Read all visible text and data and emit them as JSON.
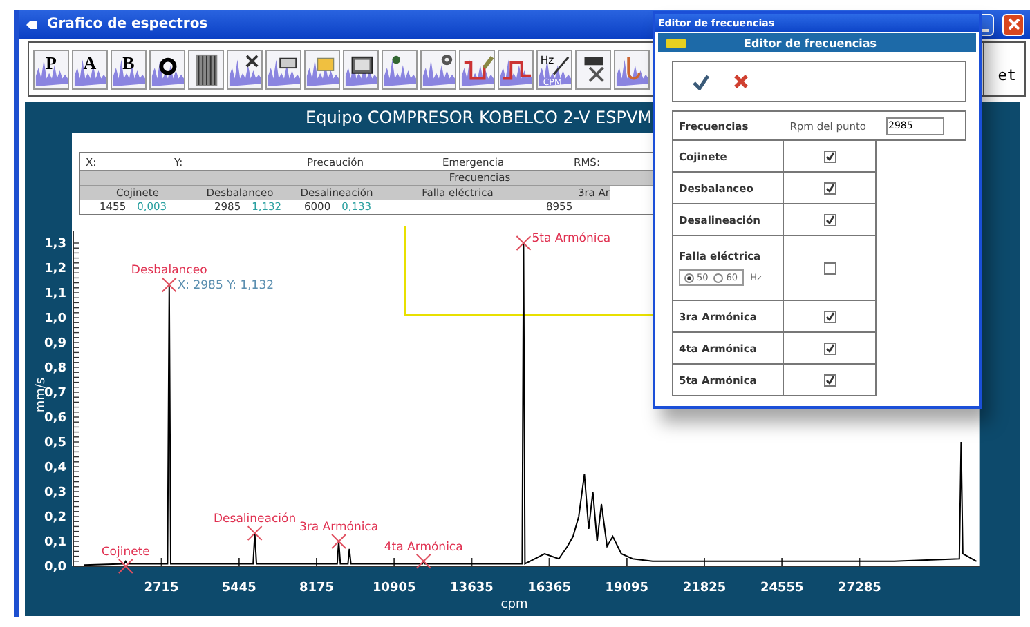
{
  "window": {
    "title": "Grafico de espectros"
  },
  "toolbar": [
    {
      "kind": "letter",
      "label": "P"
    },
    {
      "kind": "letter",
      "label": "A"
    },
    {
      "kind": "letter",
      "label": "B"
    },
    {
      "kind": "ring"
    },
    {
      "kind": "waterfall"
    },
    {
      "kind": "tools"
    },
    {
      "kind": "printer"
    },
    {
      "kind": "folder"
    },
    {
      "kind": "monitor"
    },
    {
      "kind": "bug"
    },
    {
      "kind": "gear"
    },
    {
      "kind": "trend"
    },
    {
      "kind": "step"
    },
    {
      "kind": "hz",
      "label": "Hz",
      "sublabel": "CPM"
    },
    {
      "kind": "remove"
    },
    {
      "kind": "device"
    }
  ],
  "side_button": {
    "label": "et"
  },
  "chart": {
    "title": "Equipo COMPRESOR KOBELCO 2-V ESPVM",
    "info": {
      "x_label": "X:",
      "y_label": "Y:",
      "caution": "Precaución",
      "emergency": "Emergencia",
      "rms": "RMS:",
      "group": "Frecuencias",
      "columns": [
        {
          "label": "Cojinete",
          "freq": "1455",
          "amp": "0,003"
        },
        {
          "label": "Desbalanceo",
          "freq": "2985",
          "amp": "1,132"
        },
        {
          "label": "Desalineación",
          "freq": "6000",
          "amp": "0,133"
        },
        {
          "label": "Falla eléctrica"
        },
        {
          "label": "3ra Ar",
          "freq": "8955"
        }
      ]
    },
    "chart_data": {
      "type": "line",
      "xlabel": "cpm",
      "ylabel": "mm/s",
      "xlim": [
        -390,
        31500
      ],
      "ylim": [
        0,
        1.35
      ],
      "xticks": [
        2715,
        5445,
        8175,
        10905,
        13635,
        16365,
        19095,
        21825,
        24555,
        27285
      ],
      "yticks": [
        {
          "value": 0,
          "label": "0,0"
        },
        {
          "value": 0.1,
          "label": "0,1"
        },
        {
          "value": 0.2,
          "label": "0,2"
        },
        {
          "value": 0.3,
          "label": "0,3"
        },
        {
          "value": 0.4,
          "label": "0,4"
        },
        {
          "value": 0.5,
          "label": "0,5"
        },
        {
          "value": 0.6,
          "label": "0,6"
        },
        {
          "value": 0.7,
          "label": "0,7"
        },
        {
          "value": 0.8,
          "label": "0,8"
        },
        {
          "value": 0.9,
          "label": "0,9"
        },
        {
          "value": 1,
          "label": "1,0"
        },
        {
          "value": 1.1,
          "label": "1,1"
        },
        {
          "value": 1.2,
          "label": "1,2"
        },
        {
          "value": 1.3,
          "label": "1,3"
        }
      ],
      "x": [
        0,
        1400,
        1455,
        1510,
        2930,
        2985,
        3040,
        5940,
        6000,
        6060,
        8900,
        8955,
        9010,
        9280,
        9330,
        9380,
        11900,
        11940,
        11990,
        15410,
        15460,
        15510,
        16200,
        16700,
        17000,
        17200,
        17400,
        17600,
        17750,
        17900,
        18050,
        18200,
        18400,
        18600,
        18900,
        19300,
        20000,
        22000,
        25000,
        28500,
        30800,
        30860,
        30920,
        31400
      ],
      "series": [
        {
          "color": "#000000",
          "values": [
            0.005,
            0.01,
            0.02,
            0.01,
            0.01,
            1.132,
            0.01,
            0.01,
            0.133,
            0.01,
            0.01,
            0.1,
            0.01,
            0.01,
            0.07,
            0.01,
            0.01,
            0.02,
            0.01,
            0.01,
            1.3,
            0.01,
            0.05,
            0.03,
            0.08,
            0.12,
            0.2,
            0.37,
            0.15,
            0.3,
            0.1,
            0.25,
            0.08,
            0.12,
            0.05,
            0.03,
            0.02,
            0.02,
            0.02,
            0.02,
            0.03,
            0.5,
            0.05,
            0.02
          ]
        }
      ],
      "annotations": [
        {
          "text": "Cojinete",
          "x": 1455,
          "y": 0
        },
        {
          "text": "Desbalanceo",
          "x": 2985,
          "y": 1.132
        },
        {
          "text": "Desalineación",
          "x": 6000,
          "y": 0.133
        },
        {
          "text": "3ra Armónica",
          "x": 8955,
          "y": 0.1
        },
        {
          "text": "4ta Armónica",
          "x": 11940,
          "y": 0.02
        },
        {
          "text": "5ta Armónica",
          "x": 15460,
          "y": 1.3
        }
      ]
    },
    "cursor_readout": "X: 2985 Y: 1,132"
  },
  "dialog": {
    "window_title": "Editor de frecuencias",
    "title": "Editor de frecuencias",
    "rpm_header": {
      "label": "Frecuencias",
      "rpm_label": "Rpm del punto",
      "rpm_value": "2985"
    },
    "rows": [
      {
        "kind": "check",
        "label": "Cojinete",
        "checked": true
      },
      {
        "kind": "check",
        "label": "Desbalanceo",
        "checked": true
      },
      {
        "kind": "check",
        "label": "Desalineación",
        "checked": true
      },
      {
        "kind": "electric",
        "label": "Falla eléctrica",
        "checked": false,
        "options": [
          {
            "label": "50",
            "selected": true
          },
          {
            "label": "60",
            "selected": false
          }
        ],
        "unit": "Hz"
      },
      {
        "kind": "check",
        "label": "3ra Armónica",
        "checked": true
      },
      {
        "kind": "check",
        "label": "4ta Armónica",
        "checked": true
      },
      {
        "kind": "check",
        "label": "5ta Armónica",
        "checked": true
      }
    ]
  }
}
